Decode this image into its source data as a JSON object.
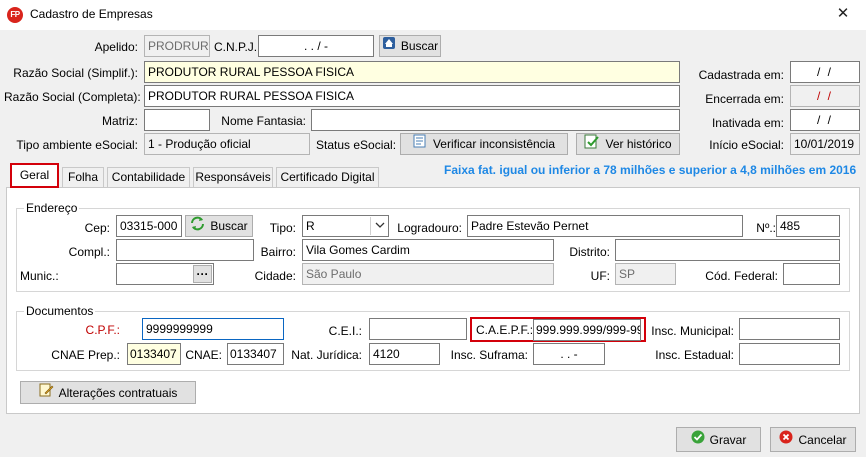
{
  "window": {
    "title": "Cadastro de Empresas",
    "app_icon": "FP",
    "close": "✕"
  },
  "header": {
    "apelido_label": "Apelido:",
    "apelido_value": "PRODRUR",
    "cnpj_label": "C.N.P.J.:",
    "cnpj_value": ". . /  -",
    "buscar_label": "Buscar",
    "razao_simpl_label": "Razão Social (Simplif.):",
    "razao_simpl_value": "PRODUTOR RURAL PESSOA FISICA",
    "razao_compl_label": "Razão Social (Completa):",
    "razao_compl_value": "PRODUTOR RURAL PESSOA FISICA",
    "matriz_label": "Matriz:",
    "matriz_value": "",
    "nome_fantasia_label": "Nome Fantasia:",
    "nome_fantasia_value": "",
    "tipo_ambiente_label": "Tipo ambiente eSocial:",
    "tipo_ambiente_value": "1 - Produção oficial",
    "status_esocial_label": "Status eSocial:",
    "verificar_label": "Verificar inconsistência",
    "historico_label": "Ver histórico",
    "cadastrada_label": "Cadastrada em:",
    "cadastrada_value": "/ /",
    "encerrada_label": "Encerrada em:",
    "encerrada_value": "/ /",
    "inativada_label": "Inativada em:",
    "inativada_value": "/ /",
    "inicio_label": "Início eSocial:",
    "inicio_value": "10/01/2019"
  },
  "tabs": {
    "geral": "Geral",
    "folha": "Folha",
    "contabilidade": "Contabilidade",
    "responsaveis": "Responsáveis",
    "certificado": "Certificado Digital"
  },
  "info_text": "Faixa fat. igual ou inferior a 78 milhões e superior a 4,8 milhões em 2016",
  "endereco": {
    "title": "Endereço",
    "cep_label": "Cep:",
    "cep_value": "03315-000",
    "buscar_label": "Buscar",
    "tipo_label": "Tipo:",
    "tipo_value": "R",
    "logradouro_label": "Logradouro:",
    "logradouro_value": "Padre Estevão Pernet",
    "numero_label": "Nº.:",
    "numero_value": "485",
    "compl_label": "Compl.:",
    "compl_value": "",
    "bairro_label": "Bairro:",
    "bairro_value": "Vila Gomes Cardim",
    "distrito_label": "Distrito:",
    "distrito_value": "",
    "munic_label": "Munic.:",
    "munic_value": "",
    "ellipsis": "···",
    "cidade_label": "Cidade:",
    "cidade_value": "São Paulo",
    "uf_label": "UF:",
    "uf_value": "SP",
    "cod_federal_label": "Cód. Federal:",
    "cod_federal_value": ""
  },
  "documentos": {
    "title": "Documentos",
    "cpf_label": "C.P.F.:",
    "cpf_value": "9999999999",
    "cei_label": "C.E.I.:",
    "cei_value": "",
    "caepf_label": "C.A.E.P.F.:",
    "caepf_value": "999.999.999/999-99",
    "insc_municipal_label": "Insc. Municipal:",
    "insc_municipal_value": "",
    "cnae_prep_label": "CNAE Prep.:",
    "cnae_prep_value": "0133407",
    "cnae_label": "CNAE:",
    "cnae_value": "0133407",
    "nat_juridica_label": "Nat. Jurídica:",
    "nat_juridica_value": "4120",
    "insc_suframa_label": "Insc. Suframa:",
    "insc_suframa_value": ". . -",
    "insc_estadual_label": "Insc. Estadual:",
    "insc_estadual_value": ""
  },
  "alteracoes_label": "Alterações contratuais",
  "footer": {
    "gravar_label": "Gravar",
    "cancelar_label": "Cancelar"
  },
  "colors": {
    "accent_red": "#d3000a",
    "info_blue": "#1e88e5",
    "required_red": "#c00000"
  }
}
